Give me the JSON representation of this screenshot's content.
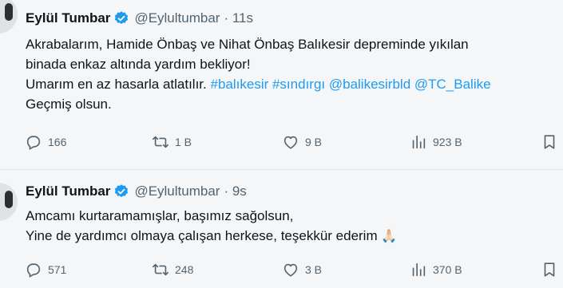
{
  "tweets": [
    {
      "name": "Eylül Tumbar",
      "handle": "@Eylultumbar",
      "time": "· 11s",
      "line1": "Akrabalarım, Hamide Önbaş ve Nihat Önbaş Balıkesir depreminde yıkılan",
      "line2": "binada enkaz altında yardım bekliyor!",
      "line3_text": "Umarım en az hasarla atlatılır.",
      "line3_links": "#balıkesir #sındırgı @balikesirbld @TC_Balike",
      "line4": "Geçmiş olsun.",
      "replies": "166",
      "retweets": "1 B",
      "likes": "9 B",
      "views": "923 B"
    },
    {
      "name": "Eylül Tumbar",
      "handle": "@Eylultumbar",
      "time": "· 9s",
      "line1": "Amcamı kurtaramamışlar, başımız sağolsun,",
      "line2": "Yine de yardımcı olmaya çalışan herkese, teşekkür ederim",
      "emoji": "🙏🏻",
      "replies": "571",
      "retweets": "248",
      "likes": "3 B",
      "views": "370 B"
    }
  ],
  "icons": {
    "verified": "verified-badge-icon",
    "reply": "reply-icon",
    "retweet": "retweet-icon",
    "like": "heart-icon",
    "views": "views-icon",
    "bookmark": "bookmark-icon"
  },
  "colors": {
    "link": "#1d9bf0",
    "muted": "#536471",
    "verified": "#1d9bf0"
  }
}
